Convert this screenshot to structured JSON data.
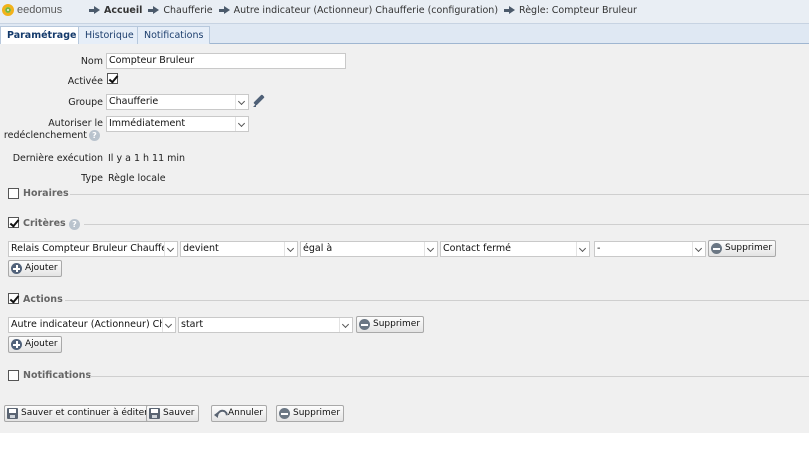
{
  "header": {
    "logo_text": "eedomus",
    "breadcrumb": [
      "Accueil",
      "Chaufferie",
      "Autre indicateur (Actionneur) Chaufferie (configuration)",
      "Règle: Compteur Bruleur"
    ]
  },
  "tabs": [
    {
      "label": "Paramétrage",
      "active": true
    },
    {
      "label": "Historique",
      "active": false
    },
    {
      "label": "Notifications",
      "active": false
    }
  ],
  "form": {
    "nom_label": "Nom",
    "nom_value": "Compteur Bruleur",
    "activee_label": "Activée",
    "activee_checked": true,
    "groupe_label": "Groupe",
    "groupe_value": "Chaufferie",
    "redecl_label_1": "Autoriser le",
    "redecl_label_2": "redéclenchement",
    "redecl_value": "Immédiatement",
    "derniere_label": "Dernière exécution",
    "derniere_value": "Il y a 1 h 11 min",
    "type_label": "Type",
    "type_value": "Règle locale"
  },
  "sections": {
    "horaires": {
      "title": "Horaires",
      "checked": false
    },
    "criteres": {
      "title": "Critères",
      "checked": true
    },
    "actions": {
      "title": "Actions",
      "checked": true
    },
    "notifications": {
      "title": "Notifications",
      "checked": false
    }
  },
  "criteria_row": {
    "device": "Relais Compteur Bruleur Chaufferi",
    "event": "devient",
    "operator": "égal à",
    "value": "Contact fermé",
    "extra": "-",
    "delete_label": "Supprimer",
    "add_label": "Ajouter"
  },
  "action_row": {
    "device": "Autre indicateur (Actionneur) Ch",
    "value": "start",
    "delete_label": "Supprimer",
    "add_label": "Ajouter"
  },
  "footer": {
    "save_continue": "Sauver et continuer à éditer",
    "save": "Sauver",
    "cancel": "Annuler",
    "delete": "Supprimer"
  },
  "colors": {
    "topbar": "#e9eef4",
    "tabs_bg": "#dfe8f3",
    "content_bg": "#f0f0f0",
    "tab_text": "#1d3f6e"
  }
}
